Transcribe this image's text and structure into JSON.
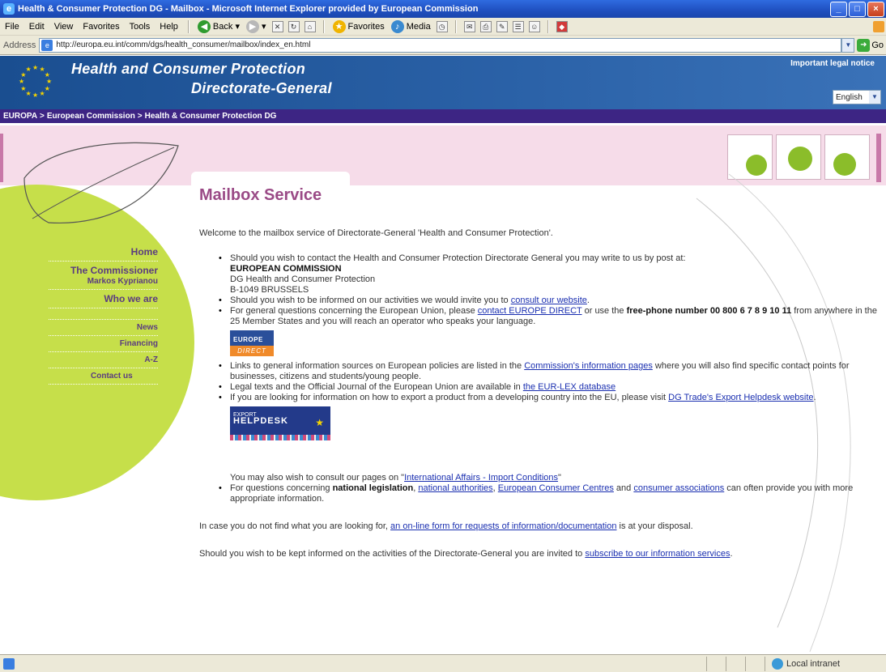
{
  "window": {
    "title": "Health & Consumer Protection DG - Mailbox - Microsoft Internet Explorer provided by European Commission",
    "minimize": "_",
    "maximize": "□",
    "close": "×"
  },
  "menu": {
    "items": [
      "File",
      "Edit",
      "View",
      "Favorites",
      "Tools",
      "Help"
    ],
    "back": "Back",
    "favorites": "Favorites",
    "media": "Media"
  },
  "address": {
    "label": "Address",
    "url": "http://europa.eu.int/comm/dgs/health_consumer/mailbox/index_en.html",
    "go": "Go"
  },
  "header": {
    "title_line1": "Health and Consumer Protection",
    "title_line2": "Directorate-General",
    "legal_notice": "Important legal notice",
    "language": "English"
  },
  "breadcrumb": [
    "EUROPA",
    "European Commission",
    "Health & Consumer Protection DG"
  ],
  "nav": {
    "home": "Home",
    "commissioner": "The Commissioner",
    "commissioner_name": "Markos Kyprianou",
    "who_we_are": "Who we are",
    "news": "News",
    "financing": "Financing",
    "az": "A-Z",
    "contact": "Contact us"
  },
  "main": {
    "title": "Mailbox Service",
    "welcome": "Welcome to the mailbox service of Directorate-General 'Health and Consumer Protection'.",
    "b1_text": "Should you wish to contact the Health and Consumer Protection Directorate General you may write to us by post at:",
    "b1_addr1": "EUROPEAN COMMISSION",
    "b1_addr2": "DG Health and Consumer Protection",
    "b1_addr3": "B-1049 BRUSSELS",
    "b2_text": "Should you wish to be informed on our activities we would invite you to ",
    "b2_link": "consult our website",
    "b2_end": ".",
    "b3_text": "For general questions concerning the European Union, please ",
    "b3_link": "contact EUROPE DIRECT",
    "b3_mid": " or use the ",
    "b3_bold": "free-phone number 00 800 6 7 8 9 10 11",
    "b3_end": " from anywhere in the 25 Member States and you will reach an operator who speaks your language.",
    "ed_logo_top": "EUROPE",
    "ed_logo_bottom": "DIRECT",
    "b4_text": "Links to general information sources on European policies are listed in the ",
    "b4_link": "Commission's information pages",
    "b4_end": " where you will also find specific contact points for businesses, citizens and students/young people.",
    "b5_text": "Legal texts and the Official Journal of the European Union are available in ",
    "b5_link": "the EUR-LEX database",
    "b6_text": "If you are looking for information on how to export a product from a developing country into the EU, please visit ",
    "b6_link": "DG Trade's Export Helpdesk website",
    "b6_end": ".",
    "eh_logo_small": "EXPORT",
    "eh_logo_big": "HELPDESK",
    "consult_text": "You may also wish to consult our pages on \"",
    "consult_link": "International Affairs - Import Conditions",
    "consult_end": "\"",
    "b7_text": "For questions concerning ",
    "b7_bold": "national legislation",
    "b7_mid": ", ",
    "b7_link1": "national authorities",
    "b7_sep1": ", ",
    "b7_link2": "European Consumer Centres",
    "b7_sep2": " and ",
    "b7_link3": "consumer associations",
    "b7_end": " can often provide you with more appropriate information.",
    "p1_text": "In case you do not find what you are looking for, ",
    "p1_link": "an on-line form for requests of information/documentation",
    "p1_end": " is at your disposal.",
    "p2_text": "Should you wish to be kept informed on the activities of the Directorate-General you are invited to ",
    "p2_link": "subscribe to our information services",
    "p2_end": "."
  },
  "status": {
    "zone": "Local intranet"
  },
  "colors": {
    "title_blue": "#1f4fbf",
    "header_blue": "#2b62a8",
    "breadcrumb_purple": "#3d2584",
    "pink_band": "#f6dce9",
    "green_circle": "#c6df4a",
    "page_title": "#9a4a86",
    "link": "#1a2fb0"
  },
  "icons": {
    "back": "back-arrow-icon",
    "forward": "forward-arrow-icon",
    "stop": "stop-icon",
    "refresh": "refresh-icon",
    "home": "home-icon",
    "search": "search-icon",
    "favorites": "star-icon",
    "media": "media-icon",
    "history": "history-icon",
    "mail": "mail-icon",
    "print": "print-icon",
    "edit": "edit-icon",
    "discuss": "discuss-icon",
    "messenger": "messenger-icon"
  }
}
